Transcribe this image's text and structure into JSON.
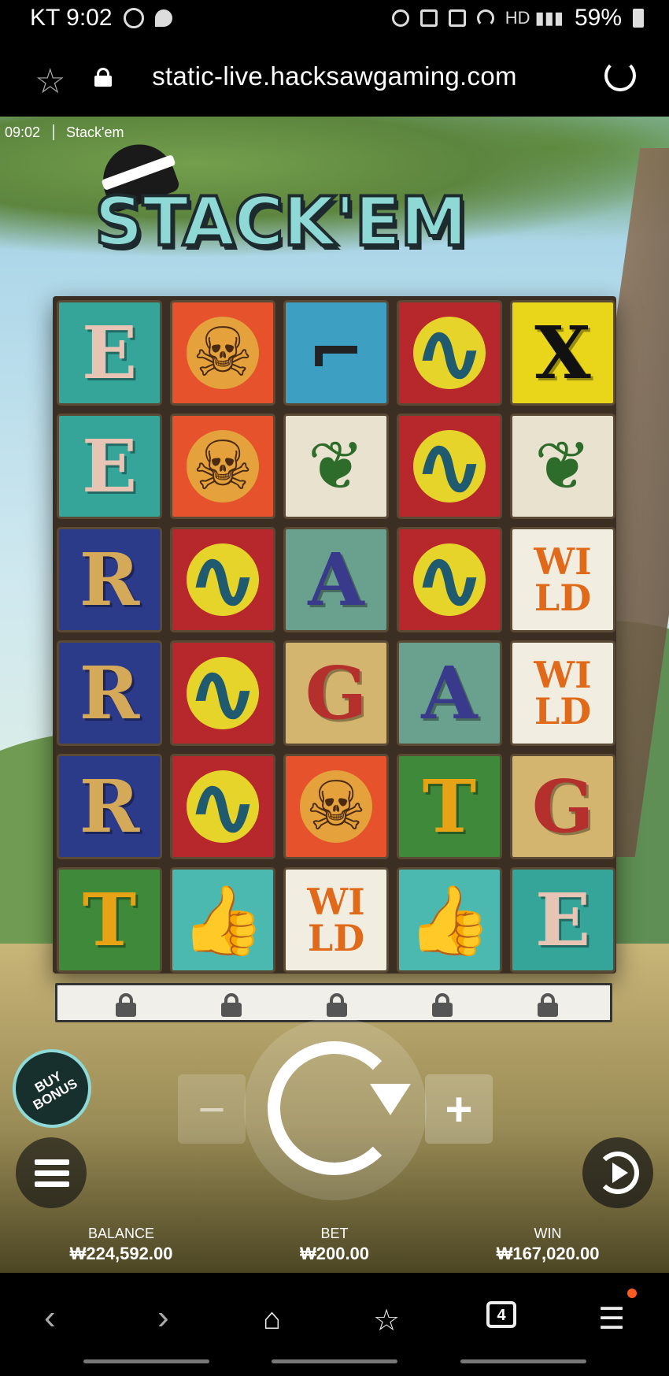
{
  "status_bar": {
    "carrier_time": "KT 9:02",
    "battery": "59%"
  },
  "browser": {
    "url": "static-live.hacksawgaming.com"
  },
  "game": {
    "clock": "09:02",
    "name": "Stack'em",
    "logo_text": "STACK'EM",
    "grid": [
      [
        {
          "s": "E",
          "bg": "#35a59a",
          "fg": "#e7c4b4"
        },
        {
          "s": "skull",
          "bg": "#e5522c",
          "fg": "#e5a23c"
        },
        {
          "s": "shoes",
          "bg": "#3d9fc2",
          "fg": "#222"
        },
        {
          "s": "snake",
          "bg": "#b7282d",
          "fg": "#e6d42a"
        },
        {
          "s": "X",
          "bg": "#e9d51a",
          "fg": "#111"
        }
      ],
      [
        {
          "s": "E",
          "bg": "#35a59a",
          "fg": "#e7c4b4"
        },
        {
          "s": "skull",
          "bg": "#e5522c",
          "fg": "#e5a23c"
        },
        {
          "s": "leaf",
          "bg": "#e9e2cf",
          "fg": "#2d6c2a"
        },
        {
          "s": "snake",
          "bg": "#b7282d",
          "fg": "#e6d42a"
        },
        {
          "s": "leaf",
          "bg": "#e9e2cf",
          "fg": "#2d6c2a"
        }
      ],
      [
        {
          "s": "R",
          "bg": "#2c3a8a",
          "fg": "#d5a95a"
        },
        {
          "s": "snake",
          "bg": "#b7282d",
          "fg": "#e6d42a"
        },
        {
          "s": "A",
          "bg": "#6aa08e",
          "fg": "#3a3a8c"
        },
        {
          "s": "snake",
          "bg": "#b7282d",
          "fg": "#e6d42a"
        },
        {
          "s": "WILD",
          "bg": "#f1ede1",
          "fg": "#e06a1a"
        }
      ],
      [
        {
          "s": "R",
          "bg": "#2c3a8a",
          "fg": "#d5a95a"
        },
        {
          "s": "snake",
          "bg": "#b7282d",
          "fg": "#e6d42a"
        },
        {
          "s": "G",
          "bg": "#d4b570",
          "fg": "#b3302c"
        },
        {
          "s": "A",
          "bg": "#6aa08e",
          "fg": "#3a3a8c"
        },
        {
          "s": "WILD",
          "bg": "#f1ede1",
          "fg": "#e06a1a"
        }
      ],
      [
        {
          "s": "R",
          "bg": "#2c3a8a",
          "fg": "#d5a95a"
        },
        {
          "s": "snake",
          "bg": "#b7282d",
          "fg": "#e6d42a"
        },
        {
          "s": "skull",
          "bg": "#e5522c",
          "fg": "#e5a23c"
        },
        {
          "s": "T",
          "bg": "#3e8a3a",
          "fg": "#e6a316"
        },
        {
          "s": "G",
          "bg": "#d4b570",
          "fg": "#b3302c"
        }
      ],
      [
        {
          "s": "T",
          "bg": "#3e8a3a",
          "fg": "#e6a316"
        },
        {
          "s": "thumb",
          "bg": "#4cb9b0",
          "fg": "#fff"
        },
        {
          "s": "WILD",
          "bg": "#f1ede1",
          "fg": "#e06a1a"
        },
        {
          "s": "thumb",
          "bg": "#4cb9b0",
          "fg": "#fff"
        },
        {
          "s": "E",
          "bg": "#35a59a",
          "fg": "#e7c4b4"
        }
      ]
    ],
    "buy_bonus_label": "BUY BONUS",
    "minus_label": "−",
    "plus_label": "+",
    "stats": {
      "balance_label": "BALANCE",
      "balance_value": "₩224,592.00",
      "bet_label": "BET",
      "bet_value": "₩200.00",
      "win_label": "WIN",
      "win_value": "₩167,020.00"
    }
  },
  "navbar": {
    "tabs_count": "4"
  }
}
